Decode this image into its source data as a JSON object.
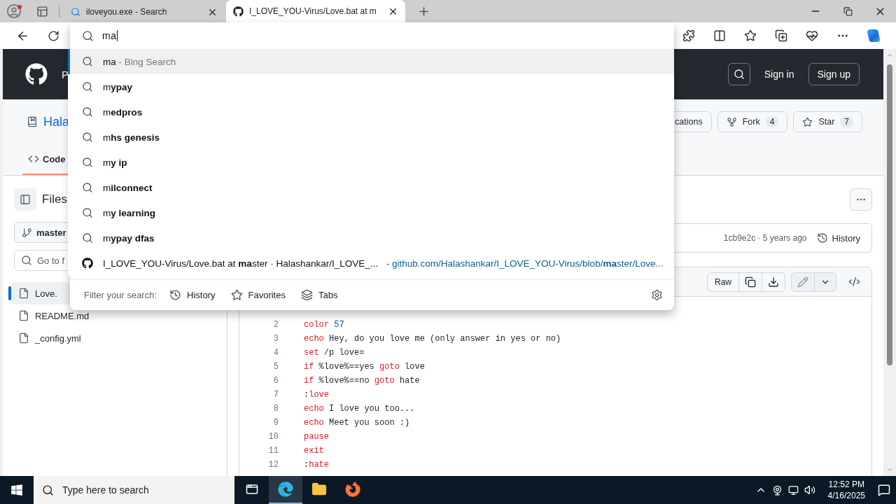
{
  "browser": {
    "tabs": [
      {
        "title": "iloveyou.exe - Search",
        "kind": "search",
        "selected": false
      },
      {
        "title": "I_LOVE_YOU-Virus/Love.bat at m",
        "kind": "github",
        "selected": true
      }
    ]
  },
  "omnibox": {
    "value": "ma",
    "suggestions": [
      {
        "kind": "search",
        "text": "ma",
        "hint": "- Bing Search",
        "selected": true
      },
      {
        "kind": "search",
        "text": "m**ypay**",
        "selected": false
      },
      {
        "kind": "search",
        "text": "m**edpros**",
        "selected": false
      },
      {
        "kind": "search",
        "text": "m**hs genesis**",
        "selected": false
      },
      {
        "kind": "search",
        "text": "m**y ip**",
        "selected": false
      },
      {
        "kind": "search",
        "text": "m**ilconnect**",
        "selected": false
      },
      {
        "kind": "search",
        "text": "m**y learning**",
        "selected": false
      },
      {
        "kind": "search",
        "text": "m**ypay dfas**",
        "selected": false
      },
      {
        "kind": "site",
        "text": "I_LOVE_YOU-Virus/Love.bat at **ma**ster · Halashankar/I_LOVE_...",
        "hint": "- github.com/Halashankar/I_LOVE_YOU-Virus/blob/**ma**ster/Love...",
        "selected": false
      }
    ],
    "filter": {
      "label": "Filter your search:",
      "options": [
        {
          "label": "History",
          "kind": "history"
        },
        {
          "label": "Favorites",
          "kind": "favorites"
        },
        {
          "label": "Tabs",
          "kind": "tabs"
        }
      ]
    }
  },
  "github": {
    "header": {
      "nav_cut": "P",
      "sign_in": "Sign in",
      "sign_up": "Sign up"
    },
    "repo": {
      "title_cut": "Hala",
      "notifications_cut": "cations",
      "fork": {
        "label": "Fork",
        "count": "4"
      },
      "star": {
        "label": "Star",
        "count": "7"
      },
      "tabs": [
        {
          "label": "Code",
          "selected": true
        }
      ]
    },
    "sidebar": {
      "title": "Files",
      "branch": "master",
      "search": {
        "placeholder": "Go to f"
      },
      "files": [
        {
          "name": "Love.",
          "selected": true
        },
        {
          "name": "README.md",
          "selected": false
        },
        {
          "name": "_config.yml",
          "selected": false
        }
      ]
    },
    "commit": {
      "meta": "1cb9e2c · 5 years ago",
      "history": "History"
    },
    "file": {
      "raw": "Raw",
      "lines": [
        {
          "number": "2",
          "tokens": [
            {
              "text": "color",
              "kind": "keyword"
            },
            {
              "text": " 57",
              "kind": "number"
            }
          ]
        },
        {
          "number": "3",
          "tokens": [
            {
              "text": "echo",
              "kind": "keyword"
            },
            {
              "text": " Hey, do you love me (only answer in yes or no)",
              "kind": "plain"
            }
          ]
        },
        {
          "number": "4",
          "tokens": [
            {
              "text": "set",
              "kind": "keyword"
            },
            {
              "text": " /p love=",
              "kind": "plain"
            }
          ]
        },
        {
          "number": "5",
          "tokens": [
            {
              "text": "if",
              "kind": "keyword"
            },
            {
              "text": " %love%==yes ",
              "kind": "plain"
            },
            {
              "text": "goto",
              "kind": "keyword"
            },
            {
              "text": " love",
              "kind": "plain"
            }
          ]
        },
        {
          "number": "6",
          "tokens": [
            {
              "text": "if",
              "kind": "keyword"
            },
            {
              "text": " %love%==no ",
              "kind": "plain"
            },
            {
              "text": "goto",
              "kind": "keyword"
            },
            {
              "text": " hate",
              "kind": "plain"
            }
          ]
        },
        {
          "number": "7",
          "tokens": [
            {
              "text": ":",
              "kind": "plain"
            },
            {
              "text": "love",
              "kind": "keyword"
            }
          ]
        },
        {
          "number": "8",
          "tokens": [
            {
              "text": "echo",
              "kind": "keyword"
            },
            {
              "text": " I love you too...",
              "kind": "plain"
            }
          ]
        },
        {
          "number": "9",
          "tokens": [
            {
              "text": "echo",
              "kind": "keyword"
            },
            {
              "text": " Meet you soon :)",
              "kind": "plain"
            }
          ]
        },
        {
          "number": "10",
          "tokens": [
            {
              "text": "pause",
              "kind": "keyword"
            }
          ]
        },
        {
          "number": "11",
          "tokens": [
            {
              "text": "exit",
              "kind": "keyword"
            }
          ]
        },
        {
          "number": "12",
          "tokens": [
            {
              "text": ":",
              "kind": "plain"
            },
            {
              "text": "hate",
              "kind": "keyword"
            }
          ]
        }
      ]
    }
  },
  "taskbar": {
    "search_placeholder": "Type here to search",
    "apps": [
      {
        "kind": "edge",
        "active": true
      },
      {
        "kind": "explorer",
        "active": false
      },
      {
        "kind": "firefox",
        "active": false
      }
    ],
    "time": "12:52 PM",
    "date": "4/16/2025"
  }
}
